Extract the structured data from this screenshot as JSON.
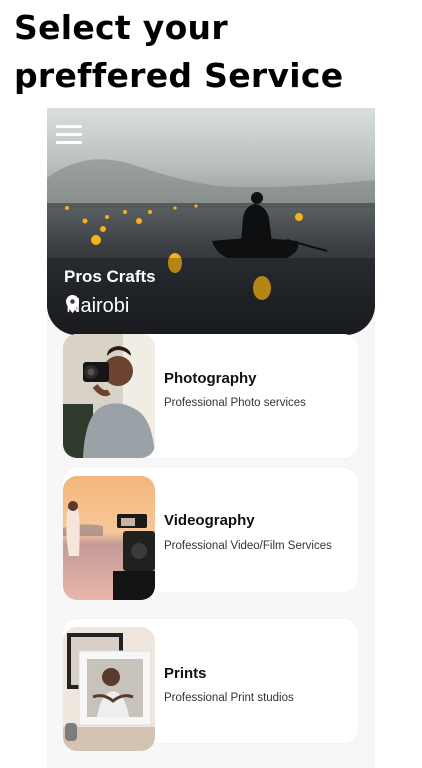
{
  "headline": {
    "line1": "Select your",
    "line2": "preffered Service"
  },
  "hero": {
    "title": "Pros Crafts",
    "location": "Nairobi"
  },
  "services": [
    {
      "title": "Photography",
      "subtitle": "Professional Photo services"
    },
    {
      "title": "Videography",
      "subtitle": "Professional Video/Film Services"
    },
    {
      "title": "Prints",
      "subtitle": "Professional Print studios"
    }
  ],
  "colors": {
    "panel": "#f7f7f7",
    "card": "#ffffff",
    "lantern": "#f2b31c"
  },
  "icons": {
    "menu": "hamburger-menu-icon",
    "location": "map-pin-icon"
  }
}
